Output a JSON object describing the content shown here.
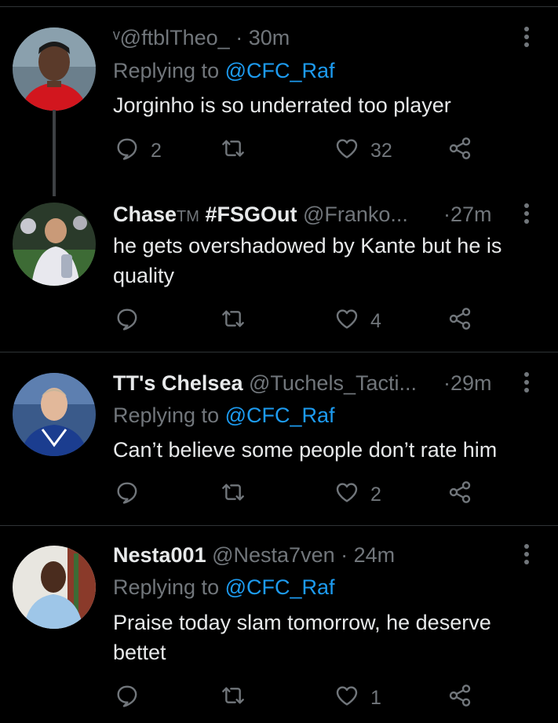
{
  "tweets": [
    {
      "display_name": "",
      "handle": "ᵛ@ftblTheo_",
      "time": "30m",
      "replying_label": "Replying to",
      "replying_to": "@CFC_Raf",
      "text": "Jorginho is so underrated too player",
      "counts": {
        "reply": "2",
        "retweet": "",
        "like": "32"
      }
    },
    {
      "display_name": "Chase",
      "name_tm": "TM",
      "name_suffix": "#FSGOut",
      "handle": "@Franko...",
      "time": "27m",
      "text": "he gets overshadowed by Kante but he is quality",
      "counts": {
        "reply": "",
        "retweet": "",
        "like": "4"
      }
    },
    {
      "display_name": "TT's Chelsea",
      "handle": "@Tuchels_Tacti...",
      "time": "29m",
      "replying_label": "Replying to",
      "replying_to": "@CFC_Raf",
      "text": "Can’t believe some people don’t rate him",
      "counts": {
        "reply": "",
        "retweet": "",
        "like": "2"
      }
    },
    {
      "display_name": "Nesta001",
      "handle": "@Nesta7ven",
      "time": "24m",
      "replying_label": "Replying to",
      "replying_to": "@CFC_Raf",
      "text": "Praise today slam tomorrow, he deserve bettet",
      "counts": {
        "reply": "",
        "retweet": "",
        "like": "1"
      }
    }
  ],
  "separator": "·",
  "colors": {
    "background": "#000000",
    "muted": "#71767b",
    "accent": "#1d9bf0",
    "text": "#e7e9ea",
    "divider": "#2f3336"
  },
  "icons": [
    "reply-icon",
    "retweet-icon",
    "like-icon",
    "share-icon",
    "more-icon"
  ]
}
